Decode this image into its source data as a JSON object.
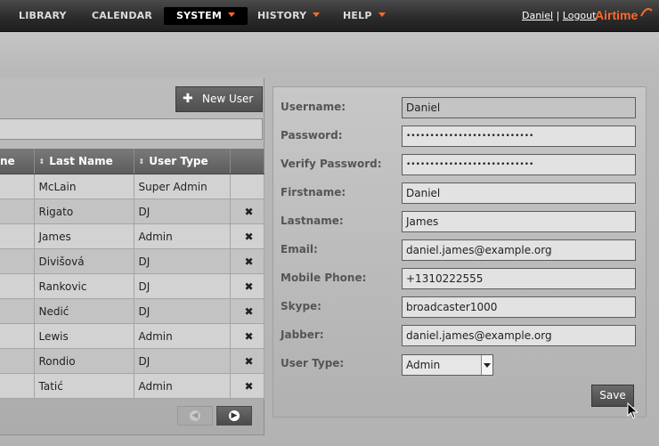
{
  "nav": {
    "items": [
      {
        "label": "LIBRARY"
      },
      {
        "label": "CALENDAR"
      },
      {
        "label": "SYSTEM"
      },
      {
        "label": "HISTORY"
      },
      {
        "label": "HELP"
      }
    ],
    "user": "Daniel",
    "separator": "|",
    "logout": "Logout",
    "brand": "Airtime",
    "accent": "#ff6a2a"
  },
  "users": {
    "new_user_label": "New User",
    "columns": [
      "ne",
      "Last Name",
      "User Type"
    ],
    "rows": [
      {
        "last": "McLain",
        "type": "Super Admin",
        "deletable": false
      },
      {
        "last": "Rigato",
        "type": "DJ",
        "deletable": true
      },
      {
        "last": "James",
        "type": "Admin",
        "deletable": true
      },
      {
        "last": "Divišová",
        "type": "DJ",
        "deletable": true
      },
      {
        "last": "Rankovic",
        "type": "DJ",
        "deletable": true
      },
      {
        "last": "Nedić",
        "type": "DJ",
        "deletable": true
      },
      {
        "last": "Lewis",
        "type": "Admin",
        "deletable": true
      },
      {
        "last": "Rondio",
        "type": "DJ",
        "deletable": true
      },
      {
        "last": "Tatić",
        "type": "Admin",
        "deletable": true
      }
    ],
    "delete_icon": "✖"
  },
  "form": {
    "username": {
      "label": "Username:",
      "value": "Daniel"
    },
    "password": {
      "label": "Password:",
      "value": "•••••••••••••••••••••••••••"
    },
    "verify_password": {
      "label": "Verify Password:",
      "value": "•••••••••••••••••••••••••••"
    },
    "firstname": {
      "label": "Firstname:",
      "value": "Daniel"
    },
    "lastname": {
      "label": "Lastname:",
      "value": "James"
    },
    "email": {
      "label": "Email:",
      "value": "daniel.james@example.org"
    },
    "mobile_phone": {
      "label": "Mobile Phone:",
      "value": "+1310222555"
    },
    "skype": {
      "label": "Skype:",
      "value": "broadcaster1000"
    },
    "jabber": {
      "label": "Jabber:",
      "value": "daniel.james@example.org"
    },
    "user_type": {
      "label": "User Type:",
      "value": "Admin"
    },
    "save_label": "Save"
  }
}
